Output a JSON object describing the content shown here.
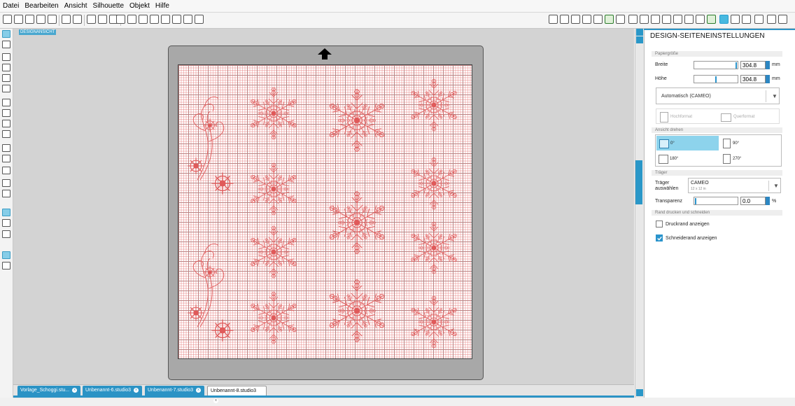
{
  "menu": [
    "Datei",
    "Bearbeiten",
    "Ansicht",
    "Silhouette",
    "Objekt",
    "Hilfe"
  ],
  "canvas": {
    "label": "DESIGNANSICHT"
  },
  "panel": {
    "title": "DESIGN-SEITENEINSTELLUNGEN",
    "paper_section": "Papiergröße",
    "width_label": "Breite",
    "width_value": "304.8",
    "width_unit": "mm",
    "height_label": "Höhe",
    "height_value": "304.8",
    "height_unit": "mm",
    "size_dropdown": "Automatisch (CAMEO)",
    "portrait": "Hochformat",
    "landscape": "Querformat",
    "rotate_section": "Ansicht drehen",
    "rot_0": "0°",
    "rot_90": "90°",
    "rot_180": "180°",
    "rot_270": "270°",
    "carrier_section": "Träger",
    "carrier_label_1": "Träger",
    "carrier_label_2": "auswählen",
    "carrier_name": "CAMEO",
    "carrier_size": "12 x 12 in",
    "transparency_label": "Transparenz",
    "transparency_value": "0.0",
    "transparency_unit": "%",
    "border_section": "Rand drucken und schneiden",
    "print_border": "Druckrand anzeigen",
    "cut_border": "Schneiderand anzeigen"
  },
  "tabs": [
    "Vorlage_Schoggi.stu...",
    "Unbenannt-6.studio3",
    "Unbenannt-7.studio3",
    "Unbenannt-8.studio3"
  ],
  "tab_close": "x",
  "colors": {
    "accent": "#2b93c5",
    "design": "#e05a5a"
  }
}
